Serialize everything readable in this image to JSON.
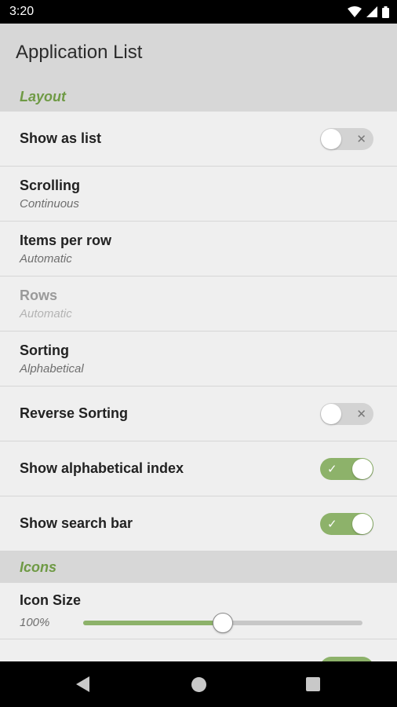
{
  "status_bar": {
    "time": "3:20",
    "icons": [
      "wifi-icon",
      "cellular-signal-icon",
      "battery-icon"
    ]
  },
  "app_bar": {
    "title": "Application List"
  },
  "sections": {
    "layout": {
      "title": "Layout",
      "show_as_list": {
        "label": "Show as list",
        "enabled": false,
        "mark": "✕"
      },
      "scrolling": {
        "label": "Scrolling",
        "value": "Continuous"
      },
      "items_per_row": {
        "label": "Items per row",
        "value": "Automatic"
      },
      "rows": {
        "label": "Rows",
        "value": "Automatic",
        "disabled": true
      },
      "sorting": {
        "label": "Sorting",
        "value": "Alphabetical"
      },
      "reverse_sorting": {
        "label": "Reverse Sorting",
        "enabled": false,
        "mark": "✕"
      },
      "show_alphabetical_index": {
        "label": "Show alphabetical index",
        "enabled": true,
        "mark": "✓"
      },
      "show_search_bar": {
        "label": "Show search bar",
        "enabled": true,
        "mark": "✓"
      }
    },
    "icons": {
      "title": "Icons",
      "icon_size": {
        "label": "Icon Size",
        "value_text": "100%",
        "fraction": 0.5
      }
    }
  },
  "colors": {
    "accent": "#8db26a",
    "section_title": "#6f9a45",
    "header_bg": "#d7d7d7",
    "list_bg": "#efefef"
  },
  "nav_bar": {
    "icons": [
      "back-icon",
      "home-icon",
      "recent-apps-icon"
    ]
  }
}
